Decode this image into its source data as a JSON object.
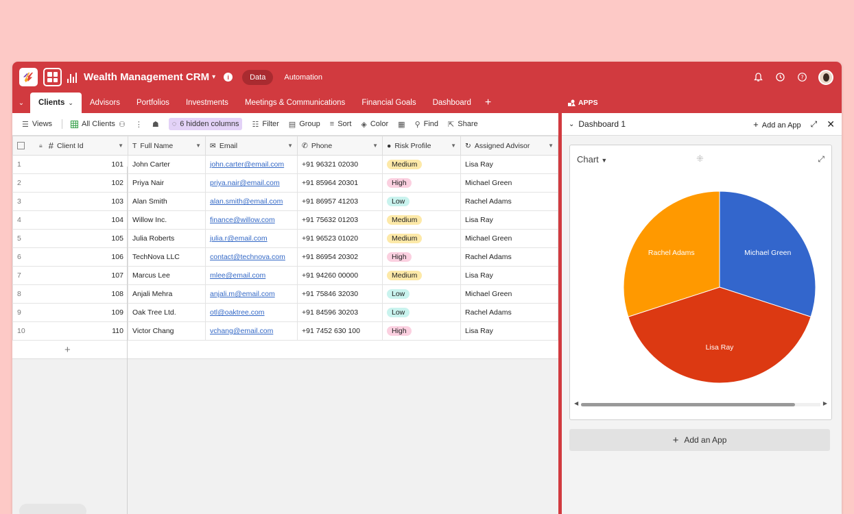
{
  "app": {
    "title": "Wealth Management CRM",
    "nav_data": "Data",
    "nav_automation": "Automation"
  },
  "tabs": [
    {
      "label": "Clients",
      "active": true
    },
    {
      "label": "Advisors"
    },
    {
      "label": "Portfolios"
    },
    {
      "label": "Investments"
    },
    {
      "label": "Meetings & Communications"
    },
    {
      "label": "Financial Goals"
    },
    {
      "label": "Dashboard"
    }
  ],
  "toolbar": {
    "views": "Views",
    "view_name": "All Clients",
    "hidden_columns": "6 hidden columns",
    "filter": "Filter",
    "group": "Group",
    "sort": "Sort",
    "color": "Color",
    "find": "Find",
    "share": "Share"
  },
  "columns": {
    "client_id": "Client Id",
    "full_name": "Full Name",
    "email": "Email",
    "phone": "Phone",
    "risk": "Risk Profile",
    "advisor": "Assigned Advisor"
  },
  "rows": [
    {
      "n": "1",
      "id": "101",
      "name": "John Carter",
      "email": "john.carter@email.com",
      "phone": "+91 96321 02030",
      "risk": "Medium",
      "advisor": "Lisa Ray"
    },
    {
      "n": "2",
      "id": "102",
      "name": "Priya Nair",
      "email": "priya.nair@email.com",
      "phone": "+91 85964 20301",
      "risk": "High",
      "advisor": "Michael Green"
    },
    {
      "n": "3",
      "id": "103",
      "name": "Alan Smith",
      "email": "alan.smith@email.com",
      "phone": "+91 86957 41203",
      "risk": "Low",
      "advisor": "Rachel Adams"
    },
    {
      "n": "4",
      "id": "104",
      "name": "Willow Inc.",
      "email": "finance@willow.com",
      "phone": "+91 75632 01203",
      "risk": "Medium",
      "advisor": "Lisa Ray"
    },
    {
      "n": "5",
      "id": "105",
      "name": "Julia Roberts",
      "email": "julia.r@email.com",
      "phone": "+91 96523 01020",
      "risk": "Medium",
      "advisor": "Michael Green"
    },
    {
      "n": "6",
      "id": "106",
      "name": "TechNova LLC",
      "email": "contact@technova.com",
      "phone": "+91 86954 20302",
      "risk": "High",
      "advisor": "Rachel Adams"
    },
    {
      "n": "7",
      "id": "107",
      "name": "Marcus Lee",
      "email": "mlee@email.com",
      "phone": "+91 94260 00000",
      "risk": "Medium",
      "advisor": "Lisa Ray"
    },
    {
      "n": "8",
      "id": "108",
      "name": "Anjali Mehra",
      "email": "anjali.m@email.com",
      "phone": "+91 75846 32030",
      "risk": "Low",
      "advisor": "Michael Green"
    },
    {
      "n": "9",
      "id": "109",
      "name": "Oak Tree Ltd.",
      "email": "otl@oaktree.com",
      "phone": "+91 84596 30203",
      "risk": "Low",
      "advisor": "Rachel Adams"
    },
    {
      "n": "10",
      "id": "110",
      "name": "Victor Chang",
      "email": "vchang@email.com",
      "phone": "+91 7452 630 100",
      "risk": "High",
      "advisor": "Lisa Ray"
    }
  ],
  "panel": {
    "apps_label": "APPS",
    "dashboard_title": "Dashboard 1",
    "add_app": "Add an App",
    "chart_label": "Chart",
    "add_app_button": "Add an App"
  },
  "colors": {
    "brand": "#d13a3f",
    "slice_michael": "#3366cc",
    "slice_lisa": "#dc3912",
    "slice_rachel": "#ff9900"
  },
  "chart_data": {
    "type": "pie",
    "categories": [
      "Michael Green",
      "Lisa Ray",
      "Rachel Adams"
    ],
    "values": [
      3,
      4,
      3
    ],
    "colors": [
      "#3366cc",
      "#dc3912",
      "#ff9900"
    ],
    "title": "",
    "legend": "none"
  }
}
